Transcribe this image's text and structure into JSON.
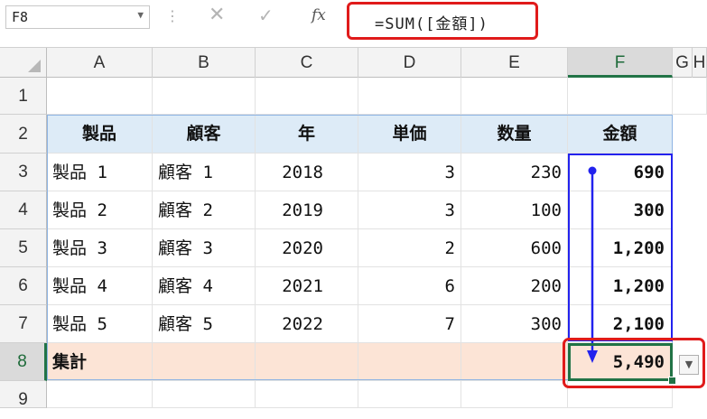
{
  "formula_bar": {
    "name_box": "F8",
    "cancel_icon": "✕",
    "enter_icon": "✓",
    "fx_label": "fx",
    "formula": "=SUM([金額])"
  },
  "columns": [
    "A",
    "B",
    "C",
    "D",
    "E",
    "F",
    "G",
    "H"
  ],
  "rows": [
    "1",
    "2",
    "3",
    "4",
    "5",
    "6",
    "7",
    "8",
    "9"
  ],
  "table": {
    "headers": [
      "製品",
      "顧客",
      "年",
      "単価",
      "数量",
      "金額"
    ],
    "data": [
      [
        "製品 1",
        "顧客 1",
        "2018",
        "3",
        "230",
        "690"
      ],
      [
        "製品 2",
        "顧客 2",
        "2019",
        "3",
        "100",
        "300"
      ],
      [
        "製品 3",
        "顧客 3",
        "2020",
        "2",
        "600",
        "1,200"
      ],
      [
        "製品 4",
        "顧客 4",
        "2021",
        "6",
        "200",
        "1,200"
      ],
      [
        "製品 5",
        "顧客 5",
        "2022",
        "7",
        "300",
        "2,100"
      ]
    ],
    "total_label": "集計",
    "total_value": "5,490"
  },
  "colors": {
    "header_fill": "#ddebf7",
    "total_fill": "#fce4d6",
    "highlight_red": "#e01b1b",
    "arrow_blue": "#2222ee",
    "selection_green": "#217346"
  }
}
